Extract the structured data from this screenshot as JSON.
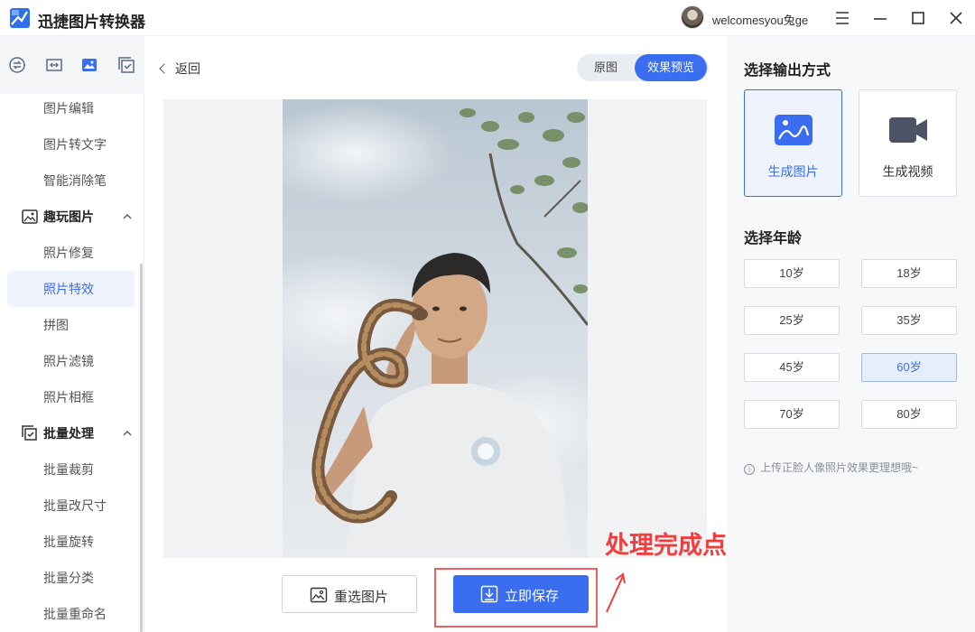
{
  "app": {
    "title": "迅捷图片转换器"
  },
  "user": {
    "name": "welcomesyou兔ge"
  },
  "sidebar": {
    "items_top": [
      {
        "label": "图片编辑"
      },
      {
        "label": "图片转文字"
      },
      {
        "label": "智能消除笔"
      }
    ],
    "section_fun": {
      "label": "趣玩图片"
    },
    "items_fun": [
      {
        "label": "照片修复"
      },
      {
        "label": "照片特效",
        "active": true
      },
      {
        "label": "拼图"
      },
      {
        "label": "照片滤镜"
      },
      {
        "label": "照片相框"
      }
    ],
    "section_batch": {
      "label": "批量处理"
    },
    "items_batch": [
      {
        "label": "批量裁剪"
      },
      {
        "label": "批量改尺寸"
      },
      {
        "label": "批量旋转"
      },
      {
        "label": "批量分类"
      },
      {
        "label": "批量重命名"
      }
    ]
  },
  "main": {
    "back_label": "返回",
    "toggle": {
      "original": "原图",
      "preview": "效果预览",
      "selected": "效果预览"
    },
    "reselect_label": "重选图片",
    "save_label": "立即保存",
    "annotation": "处理完成点击保存"
  },
  "right_panel": {
    "output_title": "选择输出方式",
    "output_options": [
      {
        "label": "生成图片",
        "icon": "image-icon",
        "selected": true
      },
      {
        "label": "生成视频",
        "icon": "video-camera-icon",
        "selected": false
      }
    ],
    "age_title": "选择年龄",
    "ages": [
      {
        "label": "10岁",
        "selected": false
      },
      {
        "label": "18岁",
        "selected": false
      },
      {
        "label": "25岁",
        "selected": false
      },
      {
        "label": "35岁",
        "selected": false
      },
      {
        "label": "45岁",
        "selected": false
      },
      {
        "label": "60岁",
        "selected": true
      },
      {
        "label": "70岁",
        "selected": false
      },
      {
        "label": "80岁",
        "selected": false
      }
    ],
    "hint": "上传正脸人像照片效果更理想哦~"
  },
  "colors": {
    "accent": "#3a6df0",
    "annotation": "#f03e3e"
  }
}
